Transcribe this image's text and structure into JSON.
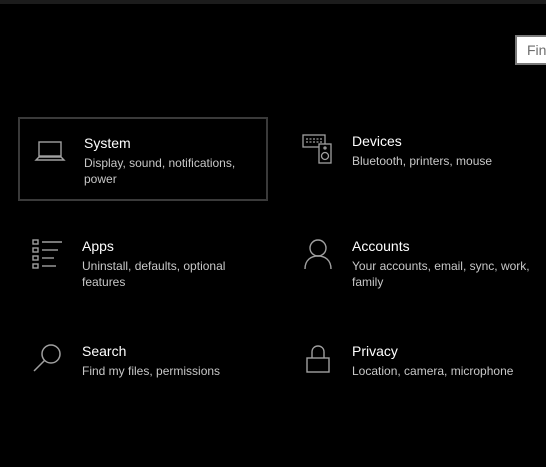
{
  "search": {
    "placeholder": "Fin"
  },
  "tiles": [
    {
      "title": "System",
      "desc": "Display, sound, notifications, power",
      "icon": "laptop-icon"
    },
    {
      "title": "Devices",
      "desc": "Bluetooth, printers, mouse",
      "icon": "keyboard-speaker-icon"
    },
    {
      "title": "Apps",
      "desc": "Uninstall, defaults, optional features",
      "icon": "app-list-icon"
    },
    {
      "title": "Accounts",
      "desc": "Your accounts, email, sync, work, family",
      "icon": "person-icon"
    },
    {
      "title": "Search",
      "desc": "Find my files, permissions",
      "icon": "magnifier-icon"
    },
    {
      "title": "Privacy",
      "desc": "Location, camera, microphone",
      "icon": "lock-icon"
    }
  ],
  "colors": {
    "background": "#000000",
    "title_text": "#ffffff",
    "desc_text": "#c8c8c8",
    "icon_stroke": "#a0a0a0",
    "selected_border": "#3a3a3a"
  }
}
